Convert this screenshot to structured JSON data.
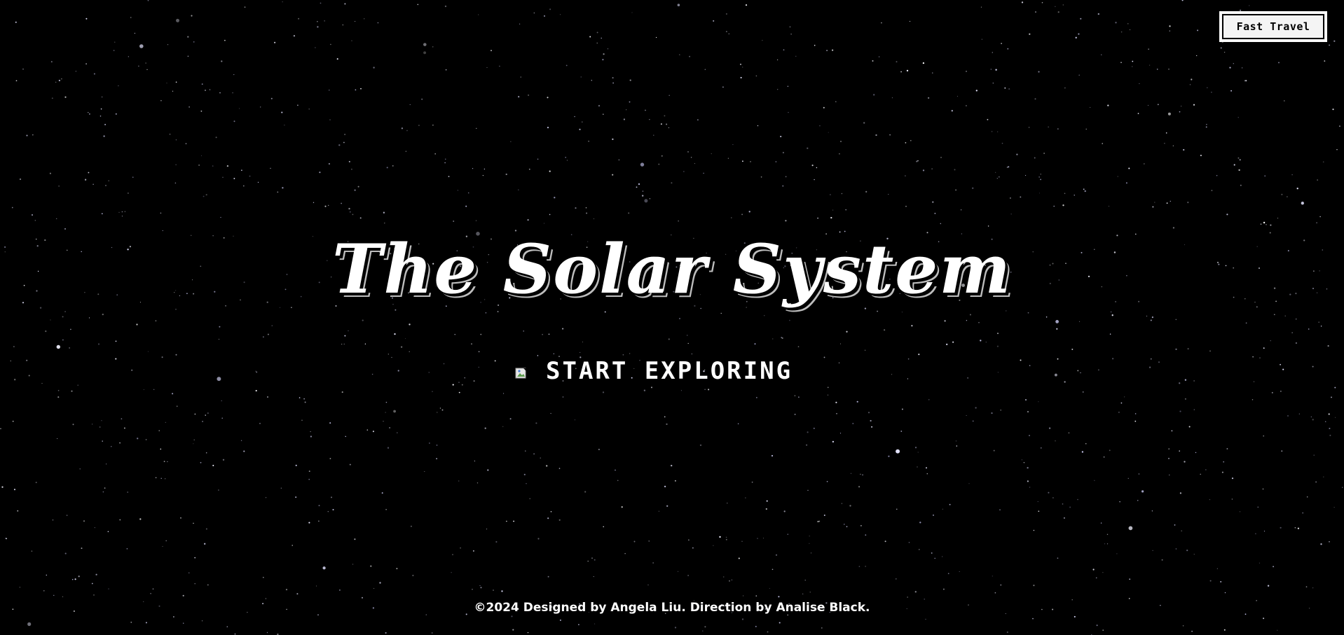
{
  "header": {
    "fast_travel_label": "Fast Travel"
  },
  "hero": {
    "title": "The Solar System",
    "start_label": "START EXPLORING",
    "start_icon": "broken-image-icon"
  },
  "footer": {
    "credit": "©2024 Designed by Angela Liu. Direction by Analise Black."
  },
  "colors": {
    "background": "#000000",
    "text": "#ffffff",
    "button_bg": "#f4f4f4"
  }
}
